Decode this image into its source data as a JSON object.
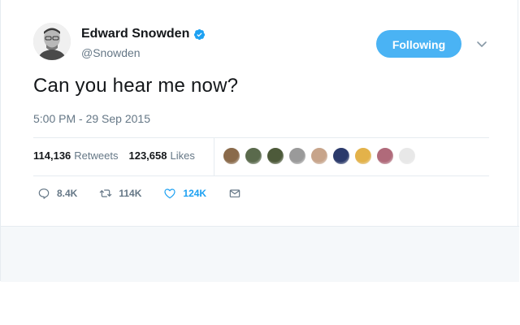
{
  "profile": {
    "name": "Edward Snowden",
    "handle": "@Snowden",
    "verified": true
  },
  "follow_button": {
    "label": "Following",
    "color": "#4ab3f4"
  },
  "tweet": {
    "text": "Can you hear me now?",
    "timestamp": "5:00 PM - 29 Sep 2015"
  },
  "stats": {
    "retweets_count": "114,136",
    "retweets_label": "Retweets",
    "likes_count": "123,658",
    "likes_label": "Likes"
  },
  "likers": [
    {
      "color": "#8a6a4a"
    },
    {
      "color": "#5a6a4c"
    },
    {
      "color": "#4d5a3a"
    },
    {
      "color": "#9a9a9a"
    },
    {
      "color": "#c7a48a"
    },
    {
      "color": "#2b3a6b"
    },
    {
      "color": "#e3b24a"
    },
    {
      "color": "#b06a7a"
    },
    {
      "color": "#e8e8e8"
    }
  ],
  "actions": {
    "reply_count": "8.4K",
    "retweet_count": "114K",
    "like_count": "124K",
    "like_color": "#1da1f2"
  },
  "icons": {
    "verified": "verified-badge-icon",
    "more": "chevron-down-icon",
    "reply": "reply-icon",
    "retweet": "retweet-icon",
    "like": "heart-icon",
    "message": "envelope-icon"
  }
}
